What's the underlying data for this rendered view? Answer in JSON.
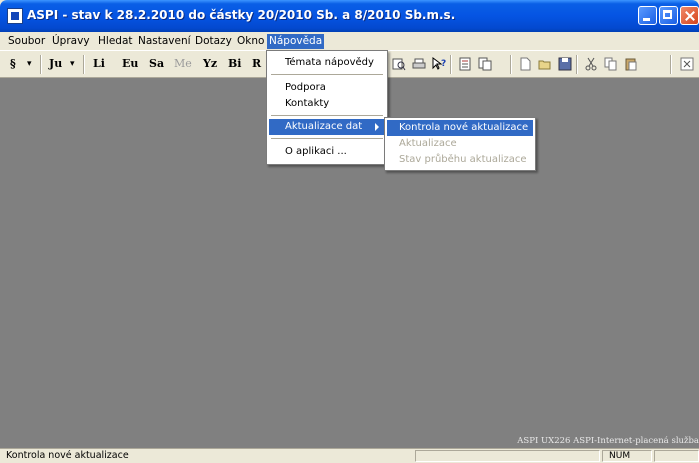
{
  "window": {
    "title": "ASPI  - stav k 28.2.2010 do částky 20/2010 Sb. a 8/2010 Sb.m.s."
  },
  "menubar": {
    "items": [
      {
        "label": "Soubor"
      },
      {
        "label": "Úpravy"
      },
      {
        "label": "Hledat"
      },
      {
        "label": "Nastavení"
      },
      {
        "label": "Dotazy"
      },
      {
        "label": "Okno"
      },
      {
        "label": "Nápověda"
      }
    ]
  },
  "toolbar": {
    "buttons": [
      {
        "label": "§"
      },
      {
        "label": "▾"
      },
      {
        "label": "Ju"
      },
      {
        "label": "▾"
      },
      {
        "label": "Li"
      },
      {
        "label": "Eu"
      },
      {
        "label": "Sa"
      },
      {
        "label": "Me"
      },
      {
        "label": "Yz"
      },
      {
        "label": "Bi"
      },
      {
        "label": "R"
      }
    ],
    "icons": [
      "print-preview-icon",
      "print-icon",
      "help-pointer-icon",
      "document-icon",
      "copy-document-icon",
      "new-document-icon",
      "open-folder-icon",
      "save-icon",
      "cut-icon",
      "copy-icon",
      "paste-icon",
      "exit-icon"
    ]
  },
  "help_menu": {
    "items": [
      {
        "label": "Témata nápovědy"
      },
      {
        "label": "Podpora"
      },
      {
        "label": "Kontakty"
      },
      {
        "label": "Aktualizace dat"
      },
      {
        "label": "O aplikaci ..."
      }
    ]
  },
  "update_submenu": {
    "items": [
      {
        "label": "Kontrola nové aktualizace"
      },
      {
        "label": "Aktualizace"
      },
      {
        "label": "Stav průběhu aktualizace"
      }
    ]
  },
  "client": {
    "footer_text": "ASPI UX226 ASPI-Internet-placená služba"
  },
  "statusbar": {
    "text": "Kontrola nové aktualizace",
    "num_indicator": "NUM"
  },
  "colors": {
    "title_bar": "#0554e3",
    "menu_highlight": "#316ac5",
    "client_background": "#808080",
    "chrome": "#ece9d8"
  }
}
